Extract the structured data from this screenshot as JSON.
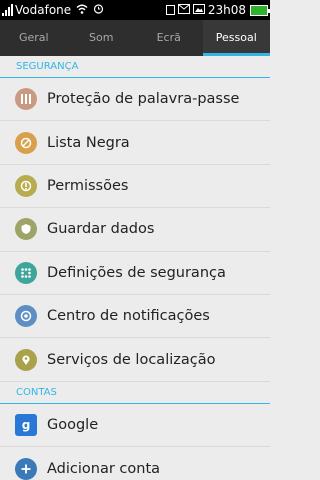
{
  "statusbar": {
    "carrier": "Vodafone",
    "time": "23h08",
    "battery_color": "#2fb12f"
  },
  "tabs": [
    {
      "label": "Geral"
    },
    {
      "label": "Som"
    },
    {
      "label": "Ecrã"
    },
    {
      "label": "Pessoal"
    }
  ],
  "sections": {
    "security": {
      "title": "SEGURANÇA",
      "items": [
        {
          "label": "Proteção de palavra-passe",
          "icon": "password-grid-icon",
          "color": "#c89a82"
        },
        {
          "label": "Lista Negra",
          "icon": "blocked-call-icon",
          "color": "#d9a04b"
        },
        {
          "label": "Permissões",
          "icon": "permission-shield-icon",
          "color": "#b7ad4f"
        },
        {
          "label": "Guardar dados",
          "icon": "data-shield-icon",
          "color": "#9ea467"
        },
        {
          "label": "Definições de segurança",
          "icon": "security-dots-icon",
          "color": "#3ea59a"
        },
        {
          "label": "Centro de notificações",
          "icon": "notification-ring-icon",
          "color": "#5e8fc4"
        },
        {
          "label": "Serviços de localização",
          "icon": "location-pin-icon",
          "color": "#a9a24a"
        }
      ]
    },
    "accounts": {
      "title": "CONTAS",
      "items": [
        {
          "label": "Google",
          "icon": "google-icon",
          "color": "#2a78d6"
        },
        {
          "label": "Adicionar conta",
          "icon": "add-account-icon",
          "color": "#3b7ab8"
        }
      ]
    }
  }
}
